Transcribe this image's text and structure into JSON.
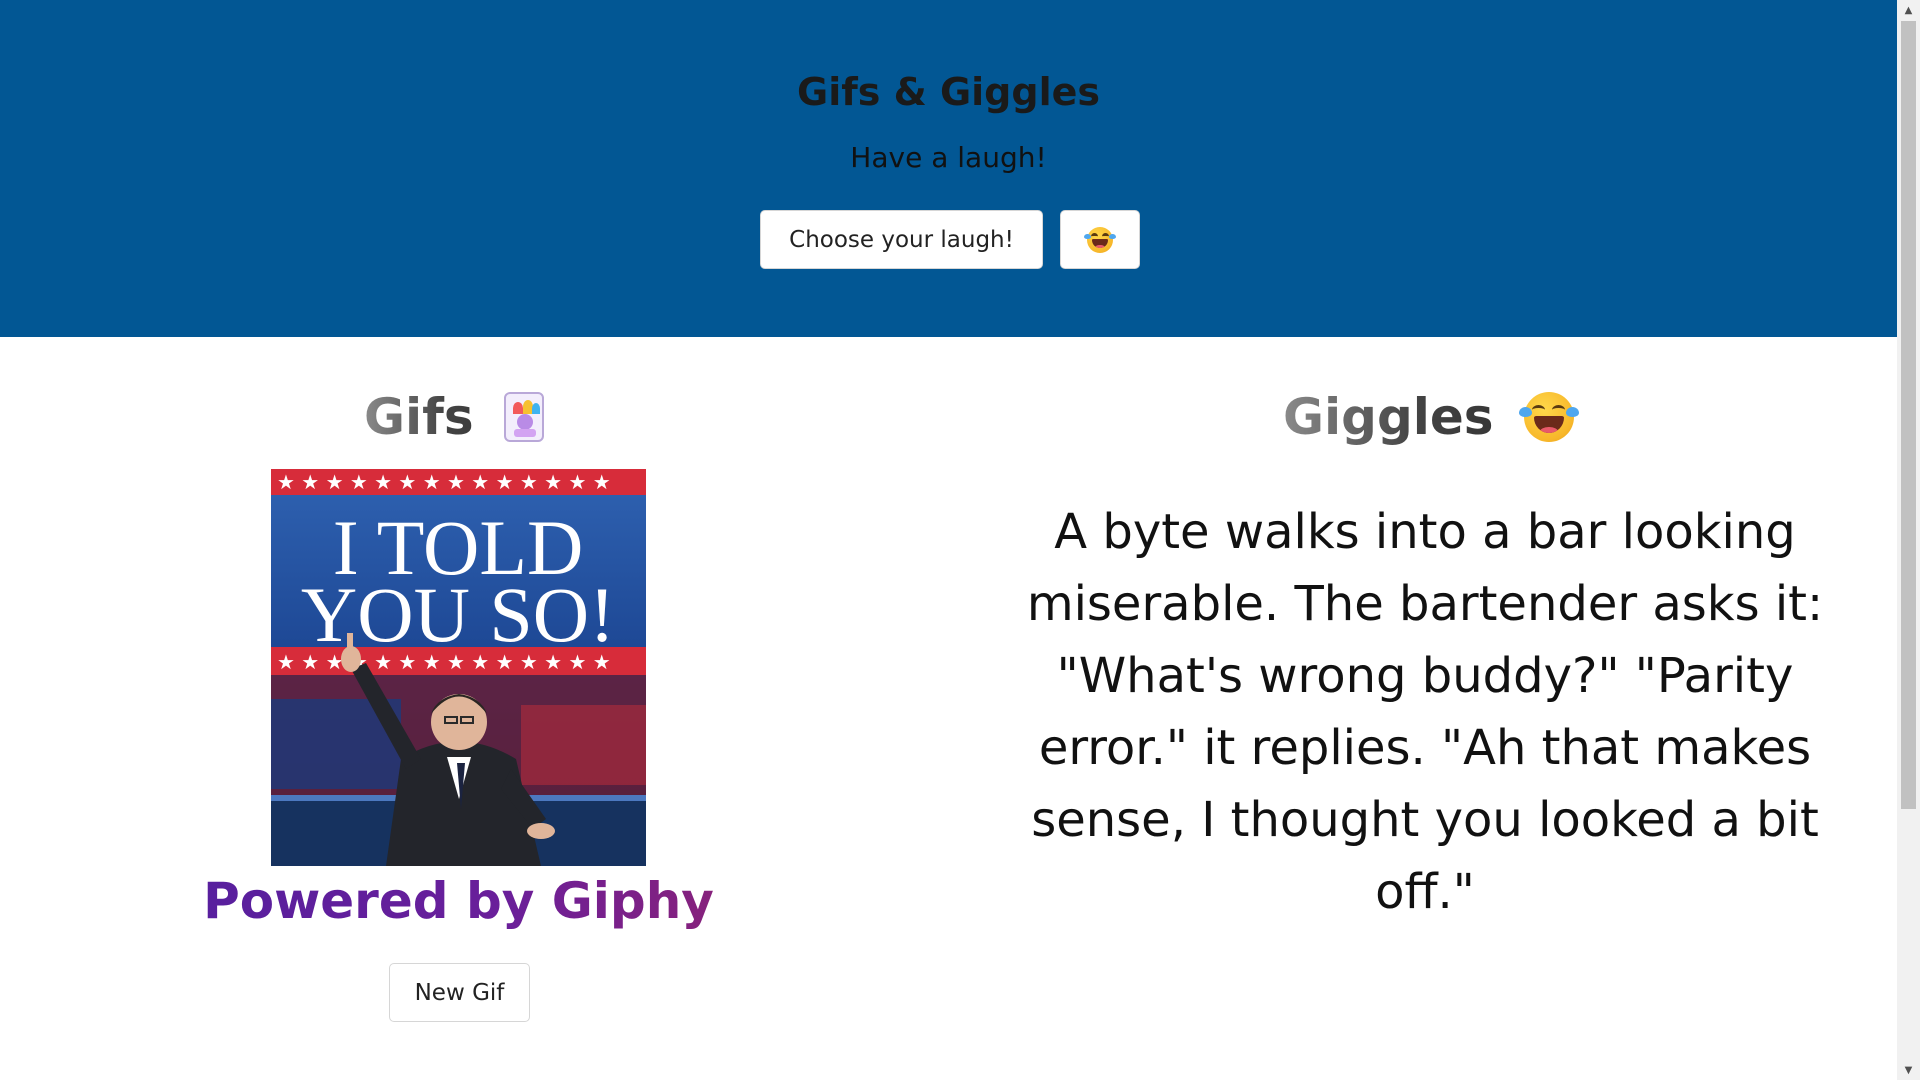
{
  "header": {
    "title": "Gifs & Giggles",
    "subtitle": "Have a laugh!",
    "choose_button_label": "Choose your laugh!",
    "emoji_button_icon": "laughing-emoji-icon",
    "background_color": "#025794"
  },
  "gifs": {
    "heading": "Gifs",
    "heading_icon": "jester-icon",
    "gif_caption_line1": "I TOLD",
    "gif_caption_line2": "YOU SO!",
    "powered_by": "Powered by Giphy",
    "new_gif_label": "New Gif"
  },
  "giggles": {
    "heading": "Giggles",
    "heading_icon": "laughing-emoji-icon",
    "joke": "A byte walks into a bar looking miserable. The bartender asks it: \"What's wrong buddy?\" \"Parity error.\" it replies. \"Ah that makes sense, I thought you looked a bit off.\""
  },
  "scrollbar": {
    "up_arrow": "▲",
    "down_arrow": "▼"
  }
}
